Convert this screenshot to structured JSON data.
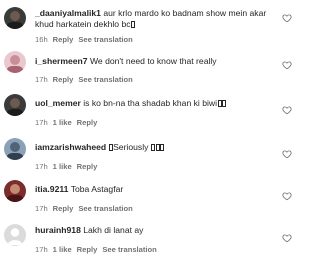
{
  "comments": [
    {
      "username": "_daaniyalmalik1",
      "text": "aur krlo mardo ko badnam show mein akar khud harkatein dekhlo bc",
      "tofu_count": 1,
      "time": "16h",
      "likes": "",
      "reply": "Reply",
      "see_translation": "See translation",
      "avatar": "dark-photo"
    },
    {
      "username": "i_shermeen7",
      "text": "We don't need to know that really",
      "tofu_count": 0,
      "time": "17h",
      "likes": "",
      "reply": "Reply",
      "see_translation": "See translation",
      "avatar": "pink-photo"
    },
    {
      "username": "uol_memer",
      "text": "is ko bn-na tha shadab khan ki biwi",
      "tofu_count": 2,
      "time": "17h",
      "likes": "1 like",
      "reply": "Reply",
      "see_translation": "",
      "avatar": "dark-photo"
    },
    {
      "username": "iamzarishwaheed",
      "text": "Seriously",
      "tofu_count": 3,
      "lead_tofu": 1,
      "time": "17h",
      "likes": "1 like",
      "reply": "Reply",
      "see_translation": "",
      "avatar": "blue-photo"
    },
    {
      "username": "itia.9211",
      "text": "Toba Astagfar",
      "tofu_count": 0,
      "time": "17h",
      "likes": "",
      "reply": "Reply",
      "see_translation": "See translation",
      "avatar": "maroon-photo"
    },
    {
      "username": "hurainh918",
      "text": "Lakh di lanat ay",
      "tofu_count": 0,
      "time": "17h",
      "likes": "1 like",
      "reply": "Reply",
      "see_translation": "See translation",
      "avatar": "default-avatar"
    }
  ],
  "colors": {
    "text": "#262626",
    "secondary": "#737373"
  },
  "icons": {
    "like": "heart-outline-icon"
  }
}
